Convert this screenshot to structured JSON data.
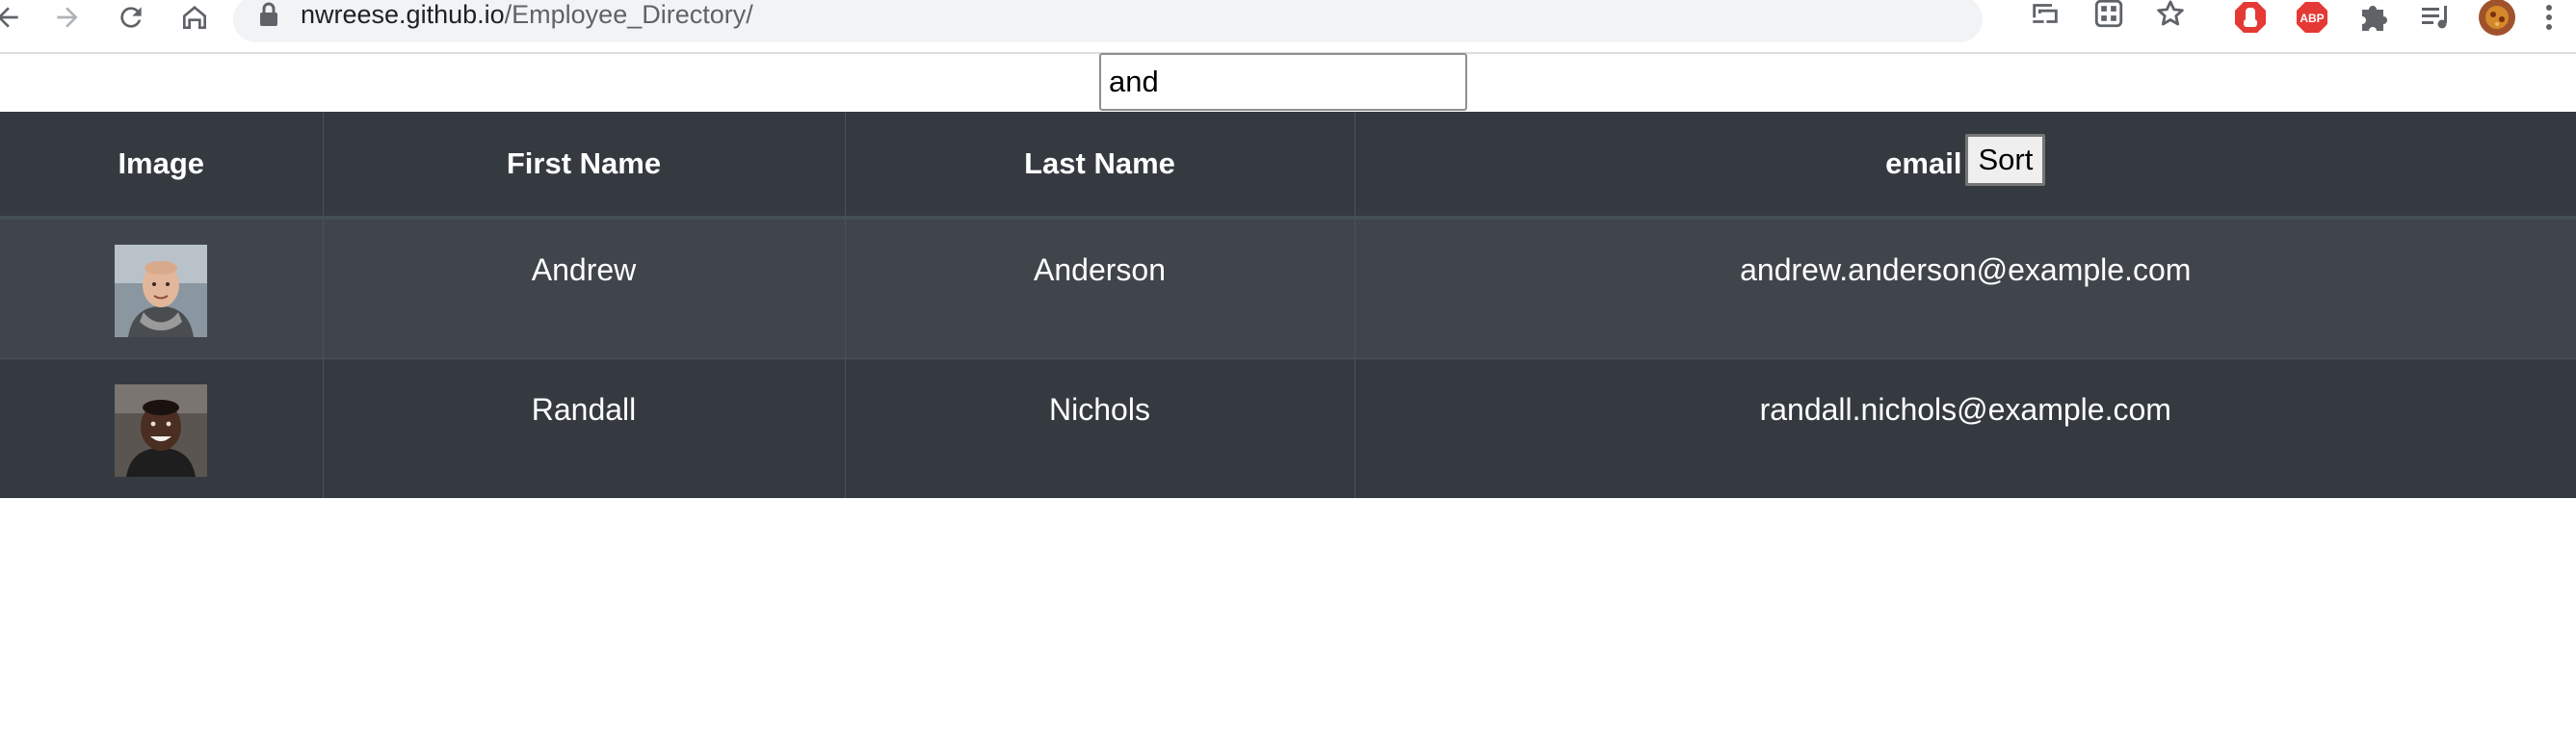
{
  "browser": {
    "url_host": "nwreese.github.io",
    "url_path": "/Employee_Directory/"
  },
  "search": {
    "value": "and"
  },
  "table": {
    "headers": {
      "image": "Image",
      "first_name": "First Name",
      "last_name": "Last Name",
      "email": "email",
      "sort_label": "Sort"
    },
    "rows": [
      {
        "first": "Andrew",
        "last": "Anderson",
        "email": "andrew.anderson@example.com"
      },
      {
        "first": "Randall",
        "last": "Nichols",
        "email": "randall.nichols@example.com"
      }
    ]
  },
  "colors": {
    "header_bg": "#343a40",
    "row_odd_bg": "#3f454b",
    "row_even_bg": "#343a40"
  },
  "icons": [
    "back-icon",
    "forward-icon",
    "reload-icon",
    "home-icon",
    "lock-icon",
    "cast-icon",
    "qr-icon",
    "bookmark-star-icon",
    "stop-extension-icon",
    "adblock-icon",
    "extensions-puzzle-icon",
    "media-playlist-icon",
    "profile-avatar-icon",
    "menu-kebab-icon"
  ]
}
